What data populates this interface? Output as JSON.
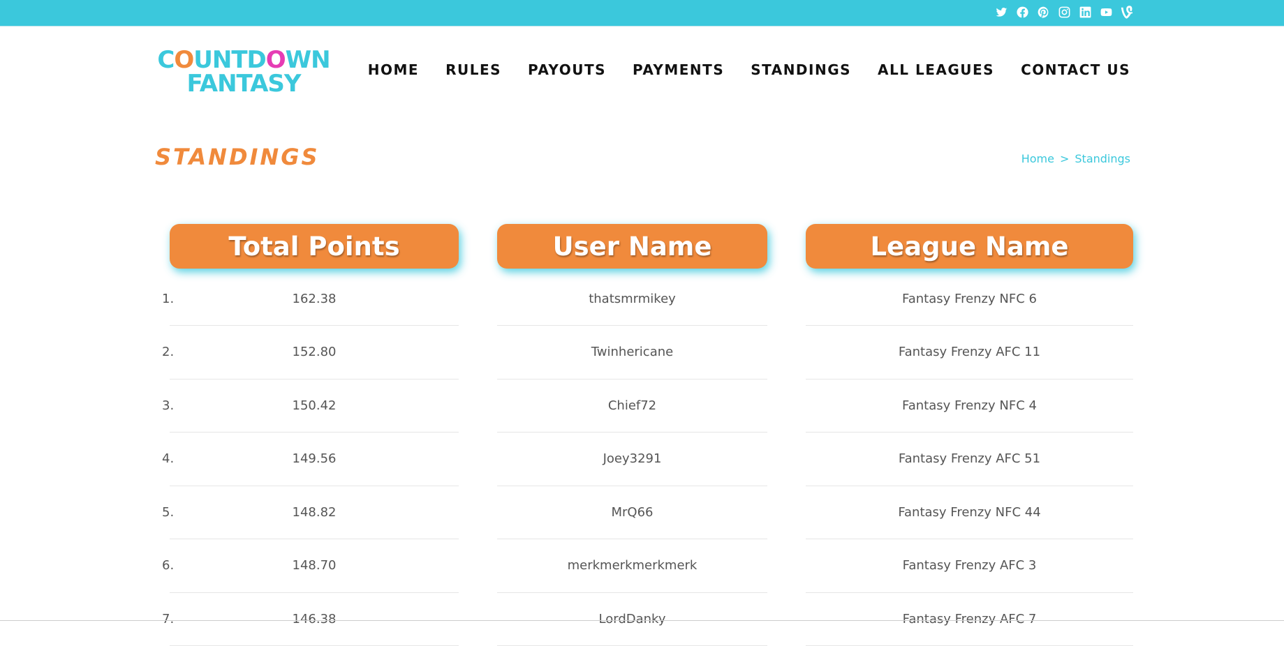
{
  "social": [
    "twitter-icon",
    "facebook-icon",
    "pinterest-icon",
    "instagram-icon",
    "linkedin-icon",
    "youtube-icon",
    "vine-icon"
  ],
  "logo": {
    "line1": "COUNTDOWN",
    "line2": "FANTASY"
  },
  "nav": [
    "HOME",
    "RULES",
    "PAYOUTS",
    "PAYMENTS",
    "STANDINGS",
    "ALL LEAGUES",
    "CONTACT US"
  ],
  "page": {
    "title": "STANDINGS"
  },
  "breadcrumb": {
    "home": "Home",
    "separator": ">",
    "current": "Standings"
  },
  "table": {
    "headers": [
      "Total Points",
      "User Name",
      "League Name"
    ],
    "rows": [
      {
        "rank": "1.",
        "points": "162.38",
        "user": "thatsmrmikey",
        "league": "Fantasy Frenzy NFC 6"
      },
      {
        "rank": "2.",
        "points": "152.80",
        "user": "Twinhericane",
        "league": "Fantasy Frenzy AFC 11"
      },
      {
        "rank": "3.",
        "points": "150.42",
        "user": "Chief72",
        "league": "Fantasy Frenzy NFC 4"
      },
      {
        "rank": "4.",
        "points": "149.56",
        "user": "Joey3291",
        "league": "Fantasy Frenzy AFC 51"
      },
      {
        "rank": "5.",
        "points": "148.82",
        "user": "MrQ66",
        "league": "Fantasy Frenzy NFC 44"
      },
      {
        "rank": "6.",
        "points": "148.70",
        "user": "merkmerkmerkmerk",
        "league": "Fantasy Frenzy AFC 3"
      },
      {
        "rank": "7.",
        "points": "146.38",
        "user": "LordDanky",
        "league": "Fantasy Frenzy AFC 7"
      }
    ]
  },
  "colors": {
    "topbar": "#3bc8dc",
    "accent": "#f08a3c",
    "logo_o_alt": "#e63cb4"
  }
}
